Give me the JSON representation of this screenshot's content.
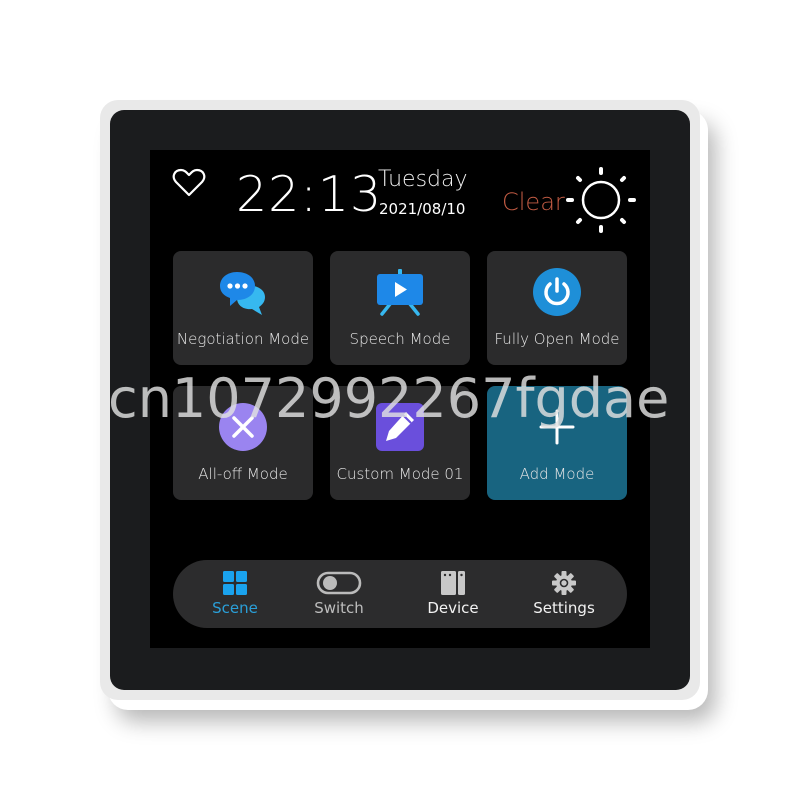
{
  "header": {
    "favorite_icon": "heart-outline-icon",
    "time": "22:13",
    "weekday": "Tuesday",
    "date": "2021/08/10",
    "weather_text": "Clear",
    "weather_icon": "sun-icon",
    "weather_color": "#c25b43"
  },
  "scenes": [
    {
      "label": "Negotiation Mode",
      "icon": "chat-bubbles-icon"
    },
    {
      "label": "Speech Mode",
      "icon": "presentation-board-icon"
    },
    {
      "label": "Fully Open Mode",
      "icon": "power-icon"
    },
    {
      "label": "All-off Mode",
      "icon": "close-circle-icon"
    },
    {
      "label": "Custom Mode 01",
      "icon": "pencil-icon"
    },
    {
      "label": "Add Mode",
      "icon": "plus-icon"
    }
  ],
  "nav": {
    "active": "Scene",
    "active_color": "#2a9fd8",
    "items": [
      {
        "label": "Scene",
        "icon": "grid-icon"
      },
      {
        "label": "Switch",
        "icon": "toggle-icon"
      },
      {
        "label": "Device",
        "icon": "device-panel-icon"
      },
      {
        "label": "Settings",
        "icon": "gear-icon"
      }
    ]
  },
  "watermark": "cn1072992267fgdae"
}
